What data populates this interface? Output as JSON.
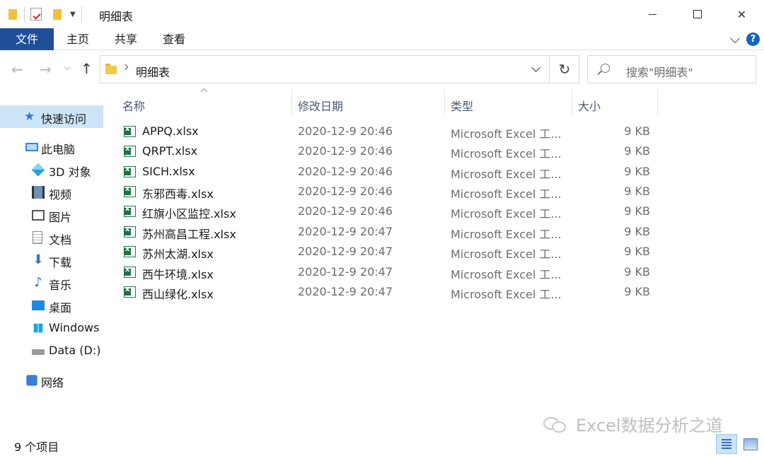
{
  "window": {
    "title": "明细表"
  },
  "ribbon": {
    "tabs": [
      "文件",
      "主页",
      "共享",
      "查看"
    ],
    "help": "?"
  },
  "nav": {
    "path": "明细表",
    "search_placeholder": "搜索\"明细表\""
  },
  "sidebar": {
    "items": [
      {
        "label": "快速访问",
        "icon": "star-icon"
      },
      {
        "label": "此电脑",
        "icon": "computer-icon"
      },
      {
        "label": "3D 对象",
        "icon": "cube-icon"
      },
      {
        "label": "视频",
        "icon": "film-icon"
      },
      {
        "label": "图片",
        "icon": "picture-icon"
      },
      {
        "label": "文档",
        "icon": "document-icon"
      },
      {
        "label": "下载",
        "icon": "download-icon"
      },
      {
        "label": "音乐",
        "icon": "music-icon"
      },
      {
        "label": "桌面",
        "icon": "desktop-icon"
      },
      {
        "label": "Windows",
        "icon": "windows-drive-icon"
      },
      {
        "label": "Data (D:)",
        "icon": "drive-icon"
      },
      {
        "label": "网络",
        "icon": "network-icon"
      }
    ]
  },
  "columns": [
    "名称",
    "修改日期",
    "类型",
    "大小"
  ],
  "files": [
    {
      "name": "APPQ.xlsx",
      "date": "2020-12-9 20:46",
      "type": "Microsoft Excel 工...",
      "size": "9 KB"
    },
    {
      "name": "QRPT.xlsx",
      "date": "2020-12-9 20:46",
      "type": "Microsoft Excel 工...",
      "size": "9 KB"
    },
    {
      "name": "SICH.xlsx",
      "date": "2020-12-9 20:46",
      "type": "Microsoft Excel 工...",
      "size": "9 KB"
    },
    {
      "name": "东邪西毒.xlsx",
      "date": "2020-12-9 20:46",
      "type": "Microsoft Excel 工...",
      "size": "9 KB"
    },
    {
      "name": "红旗小区监控.xlsx",
      "date": "2020-12-9 20:46",
      "type": "Microsoft Excel 工...",
      "size": "9 KB"
    },
    {
      "name": "苏州高昌工程.xlsx",
      "date": "2020-12-9 20:47",
      "type": "Microsoft Excel 工...",
      "size": "9 KB"
    },
    {
      "name": "苏州太湖.xlsx",
      "date": "2020-12-9 20:47",
      "type": "Microsoft Excel 工...",
      "size": "9 KB"
    },
    {
      "name": "西牛环境.xlsx",
      "date": "2020-12-9 20:47",
      "type": "Microsoft Excel 工...",
      "size": "9 KB"
    },
    {
      "name": "西山绿化.xlsx",
      "date": "2020-12-9 20:47",
      "type": "Microsoft Excel 工...",
      "size": "9 KB"
    }
  ],
  "status": {
    "count": "9 个项目"
  },
  "watermark": "Excel数据分析之道"
}
